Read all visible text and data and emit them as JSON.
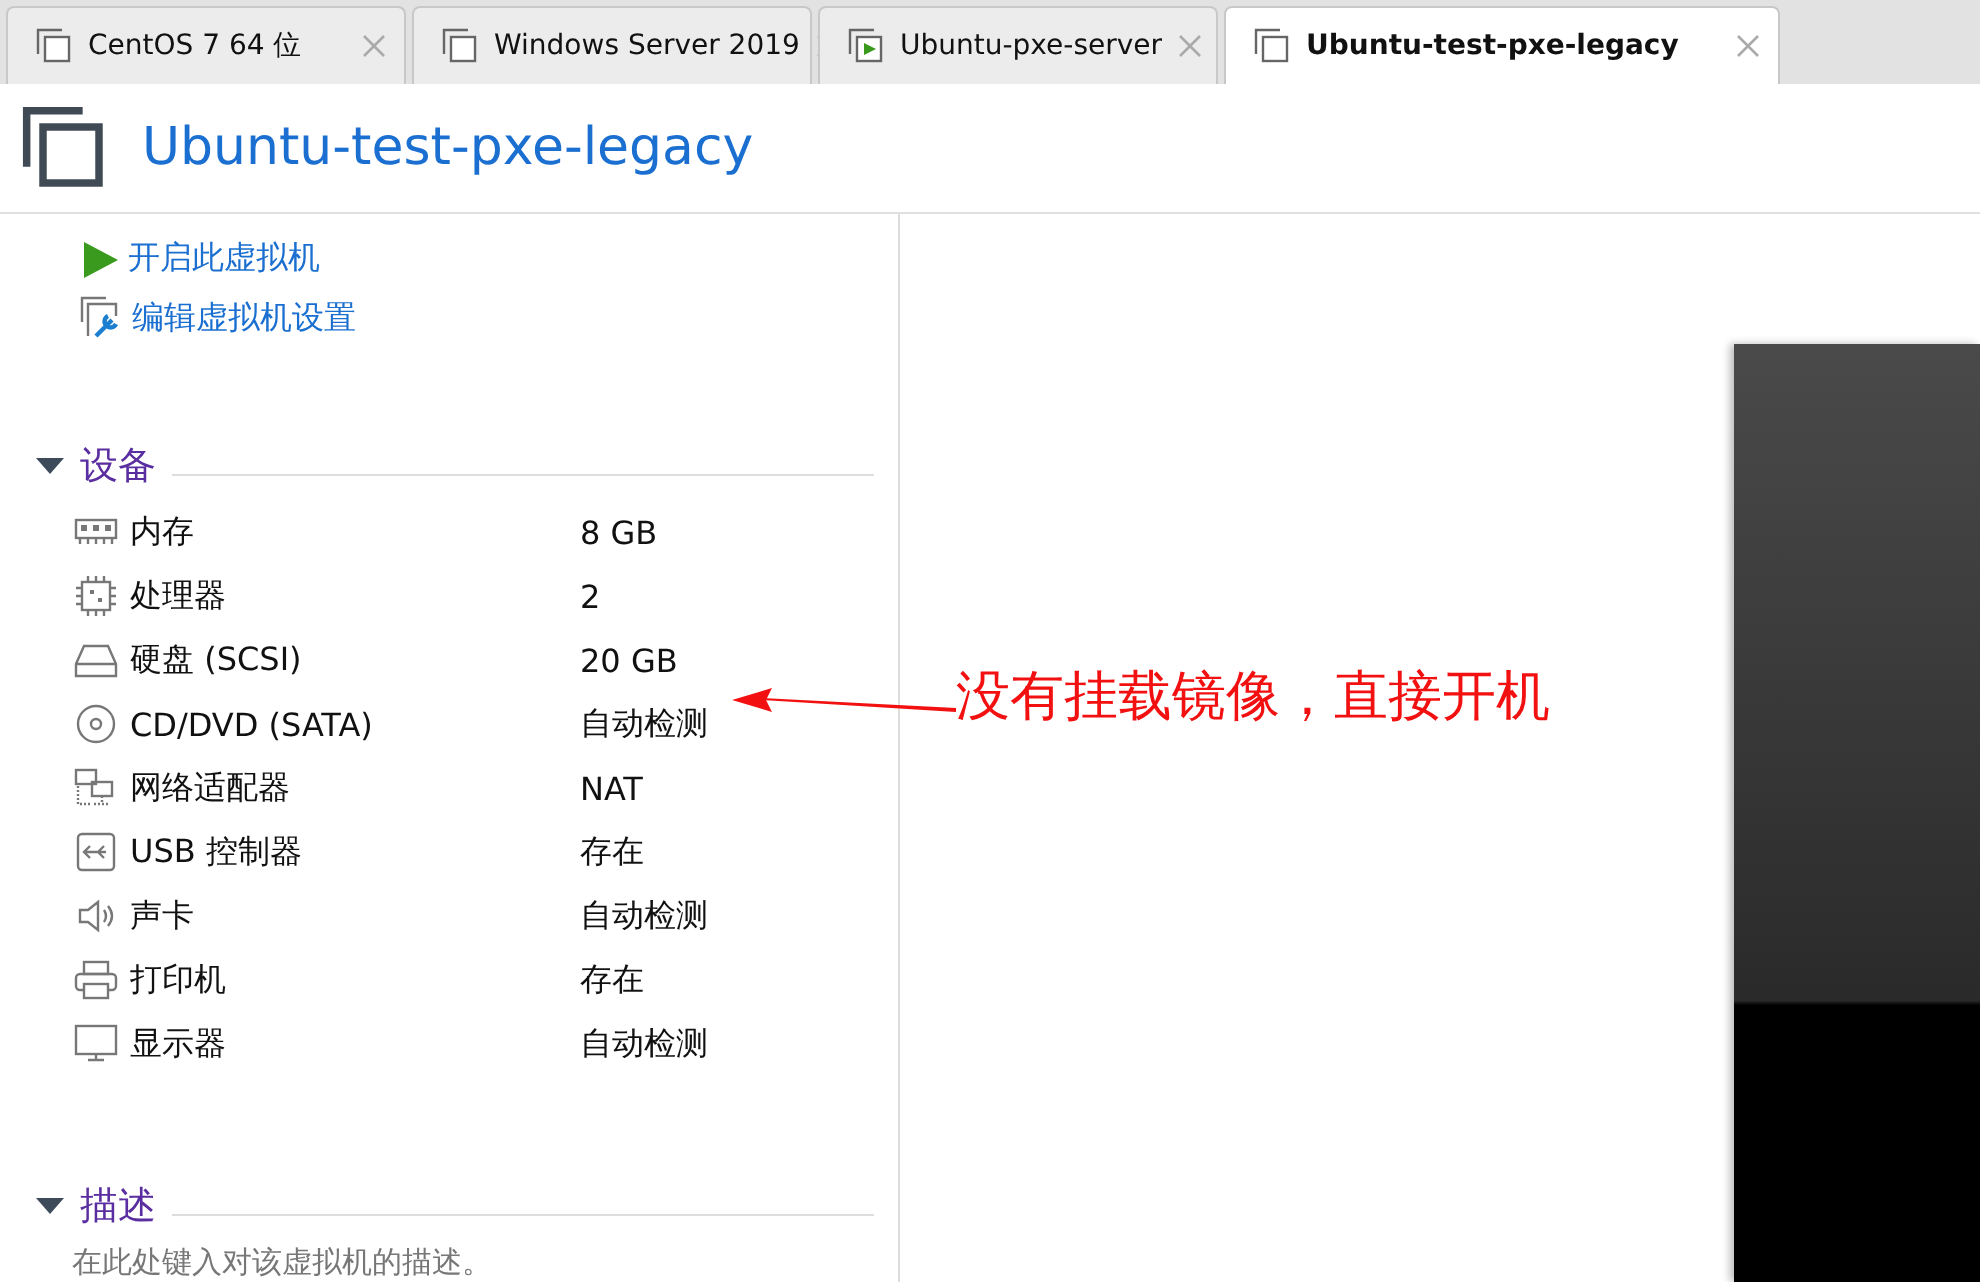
{
  "tabs": [
    {
      "label": "CentOS 7 64 位",
      "kind": "vm",
      "selected": false
    },
    {
      "label": "Windows Server 2019",
      "kind": "vm",
      "selected": false
    },
    {
      "label": "Ubuntu-pxe-server",
      "kind": "vm-running",
      "selected": false
    },
    {
      "label": "Ubuntu-test-pxe-legacy",
      "kind": "vm",
      "selected": true
    }
  ],
  "title": "Ubuntu-test-pxe-legacy",
  "actions": [
    {
      "label": "开启此虚拟机",
      "kind": "power-on"
    },
    {
      "label": "编辑虚拟机设置",
      "kind": "edit"
    }
  ],
  "devices_section": {
    "title": "设备",
    "expanded": true,
    "items": [
      {
        "kind": "memory",
        "name": "内存",
        "value": "8 GB"
      },
      {
        "kind": "processor",
        "name": "处理器",
        "value": "2"
      },
      {
        "kind": "disk",
        "name": "硬盘 (SCSI)",
        "value": "20 GB"
      },
      {
        "kind": "cd",
        "name": "CD/DVD (SATA)",
        "value": "自动检测"
      },
      {
        "kind": "network",
        "name": "网络适配器",
        "value": "NAT"
      },
      {
        "kind": "usb",
        "name": "USB 控制器",
        "value": "存在"
      },
      {
        "kind": "sound",
        "name": "声卡",
        "value": "自动检测"
      },
      {
        "kind": "printer",
        "name": "打印机",
        "value": "存在"
      },
      {
        "kind": "display",
        "name": "显示器",
        "value": "自动检测"
      }
    ]
  },
  "description_section": {
    "title": "描述",
    "expanded": true,
    "placeholder": "在此处键入对该虚拟机的描述。"
  },
  "annotation": {
    "text": "没有挂载镜像，直接开机"
  }
}
